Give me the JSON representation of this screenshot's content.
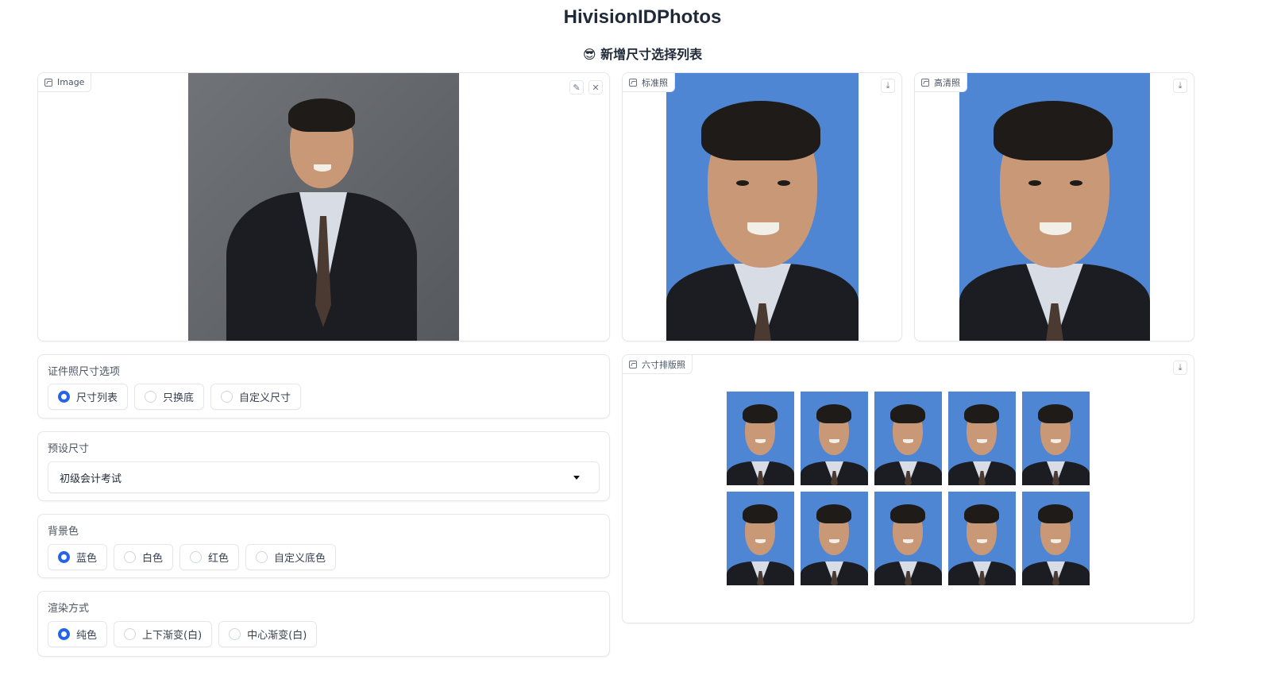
{
  "header": {
    "title": "HivisionIDPhotos",
    "subtitle": "😎 新增尺寸选择列表"
  },
  "input_image": {
    "label": "Image",
    "edit_icon": "pencil-icon",
    "clear_icon": "close-icon"
  },
  "outputs": {
    "standard": {
      "label": "标准照",
      "download_icon": "download-icon"
    },
    "hd": {
      "label": "高清照",
      "download_icon": "download-icon"
    },
    "layout": {
      "label": "六寸排版照",
      "download_icon": "download-icon",
      "rows": 2,
      "cols": 5
    }
  },
  "size_options": {
    "label": "证件照尺寸选项",
    "options": [
      "尺寸列表",
      "只换底",
      "自定义尺寸"
    ],
    "selected": "尺寸列表"
  },
  "preset_size": {
    "label": "预设尺寸",
    "value": "初级会计考试"
  },
  "background_color": {
    "label": "背景色",
    "options": [
      "蓝色",
      "白色",
      "红色",
      "自定义底色"
    ],
    "selected": "蓝色"
  },
  "render_mode": {
    "label": "渲染方式",
    "options": [
      "纯色",
      "上下渐变(白)",
      "中心渐变(白)"
    ],
    "selected": "纯色"
  },
  "colors": {
    "id_background": "#4f86d4",
    "accent": "#2563eb"
  }
}
